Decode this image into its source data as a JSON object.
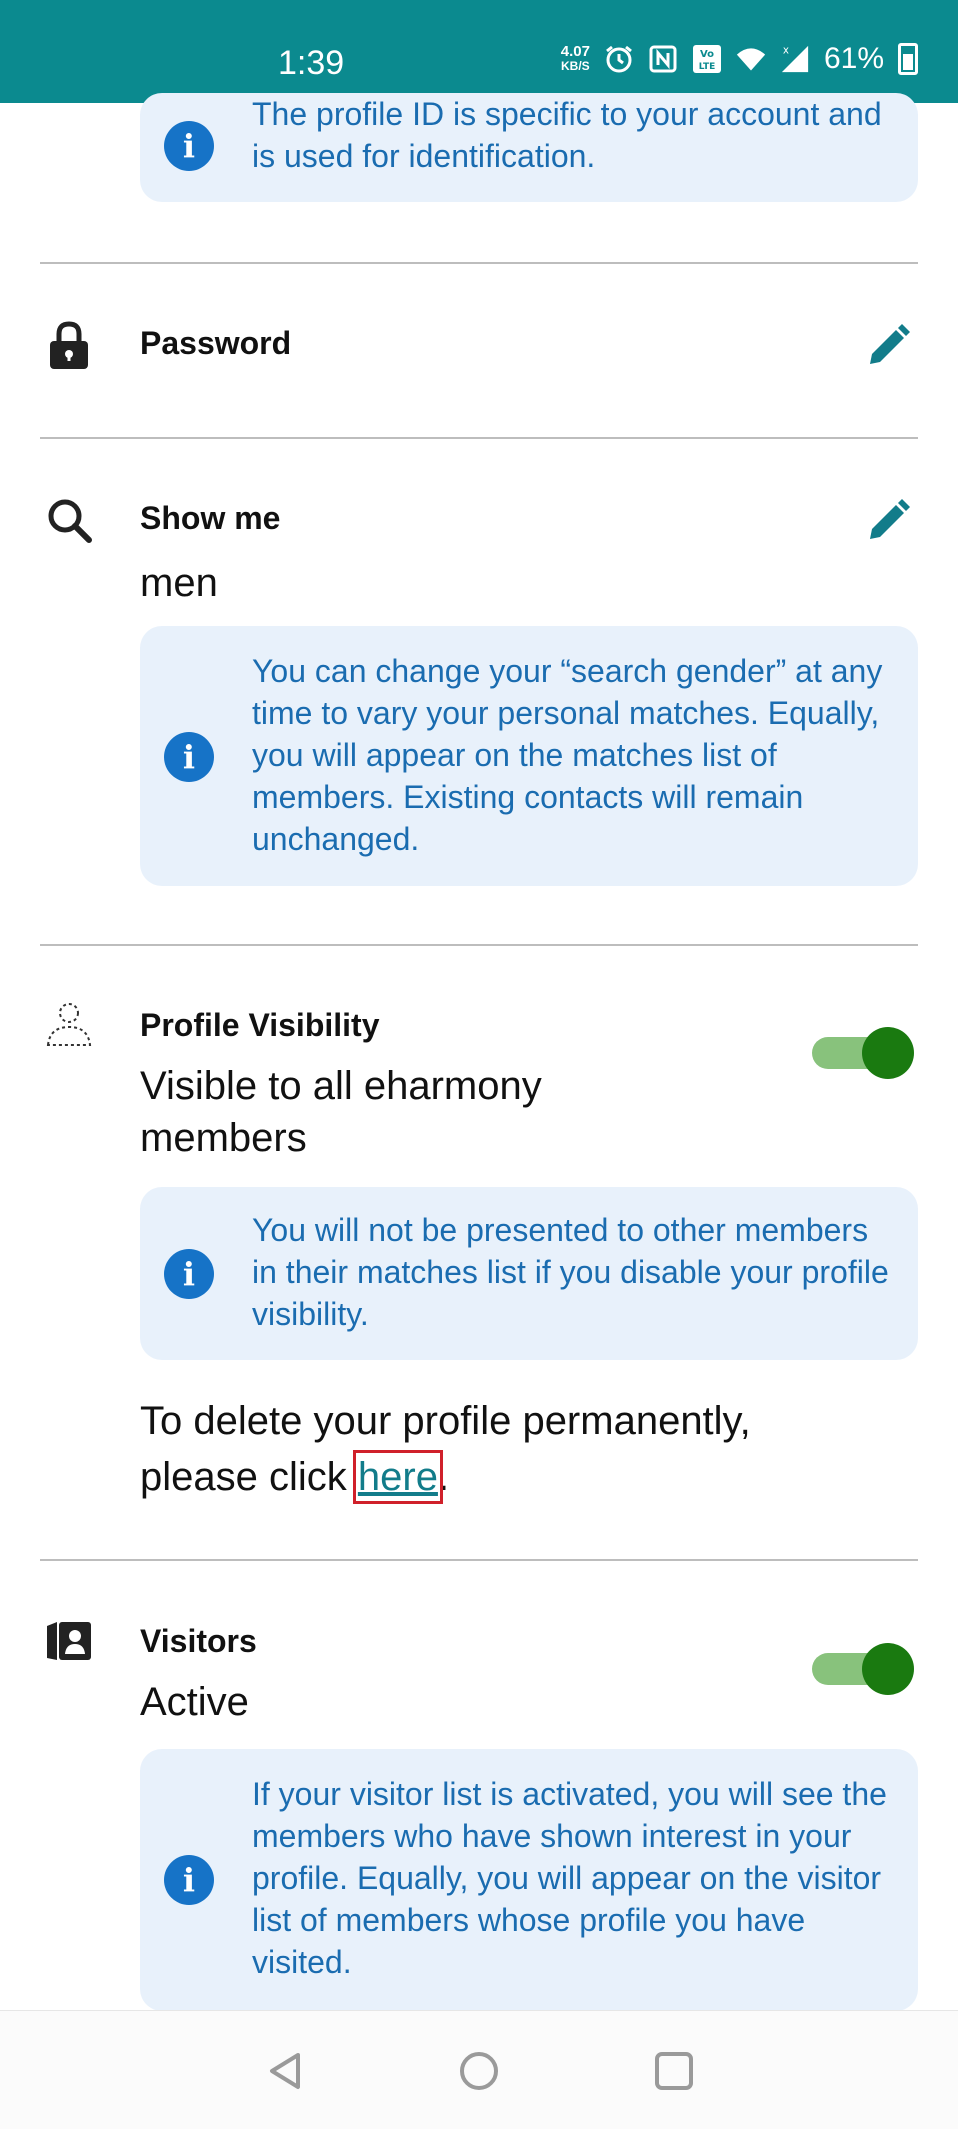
{
  "status_bar": {
    "time": "1:39",
    "net_speed_value": "4.07",
    "net_speed_unit": "KB/S",
    "battery": "61%",
    "icons": [
      "alarm-icon",
      "nfc-icon",
      "volte-icon",
      "wifi-icon",
      "signal-icon",
      "battery-icon"
    ]
  },
  "profile_id_info": {
    "text": "The profile ID is specific to your account and is used for identification."
  },
  "password": {
    "title": "Password",
    "icon": "lock-icon"
  },
  "show_me": {
    "title": "Show me",
    "value": "men",
    "info": "You can change your “search gender” at any time to vary your personal matches. Equally, you will appear on the matches list of members. Existing contacts will remain unchanged."
  },
  "profile_visibility": {
    "title": "Profile Visibility",
    "value": "Visible to all eharmony members",
    "toggle_on": true,
    "info": "You will not be presented to other members in their matches list if you disable your profile visibility."
  },
  "delete_profile": {
    "text_before": "To delete your profile permanently, please click ",
    "link_text": "here",
    "text_after": "."
  },
  "visitors": {
    "title": "Visitors",
    "value": "Active",
    "toggle_on": true,
    "info": "If your visitor list is activated, you will see the members who have shown interest in your profile. Equally, you will appear on the visitor list of members whose profile you have visited."
  },
  "colors": {
    "status_bar": "#0b8a8f",
    "accent": "#127c8a",
    "info_bg": "#e8f1fb",
    "info_text": "#1a6cb0",
    "toggle_knob": "#1a7a10",
    "toggle_track": "#88c27c"
  }
}
